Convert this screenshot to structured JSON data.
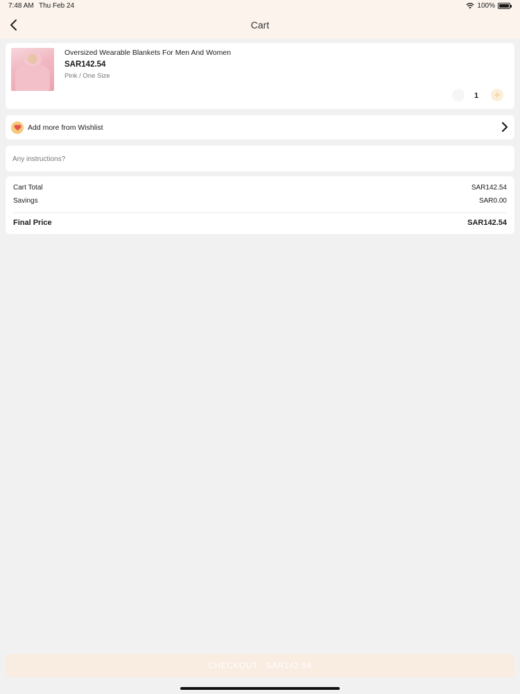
{
  "status_bar": {
    "time": "7:48 AM",
    "date": "Thu Feb 24",
    "battery": "100%",
    "battery_level": 1.0
  },
  "nav": {
    "title": "Cart",
    "back_icon": "chevron-left-icon"
  },
  "cart_item": {
    "name": "Oversized Wearable Blankets For Men And Women",
    "price": "SAR142.54",
    "variant": "Pink / One Size",
    "quantity": "1"
  },
  "wishlist": {
    "label": "Add more from Wishlist",
    "icon": "heart-icon",
    "icon_color": "#e2564d",
    "badge_color": "#f6c97c"
  },
  "instructions": {
    "placeholder": "Any instructions?"
  },
  "summary": {
    "cart_total_label": "Cart Total",
    "cart_total_value": "SAR142.54",
    "savings_label": "Savings",
    "savings_value": "SAR0.00",
    "final_price_label": "Final Price",
    "final_price_value": "SAR142.54"
  },
  "checkout": {
    "label": "CHECKOUT - SAR142.54",
    "background_color": "#f9ece1"
  }
}
